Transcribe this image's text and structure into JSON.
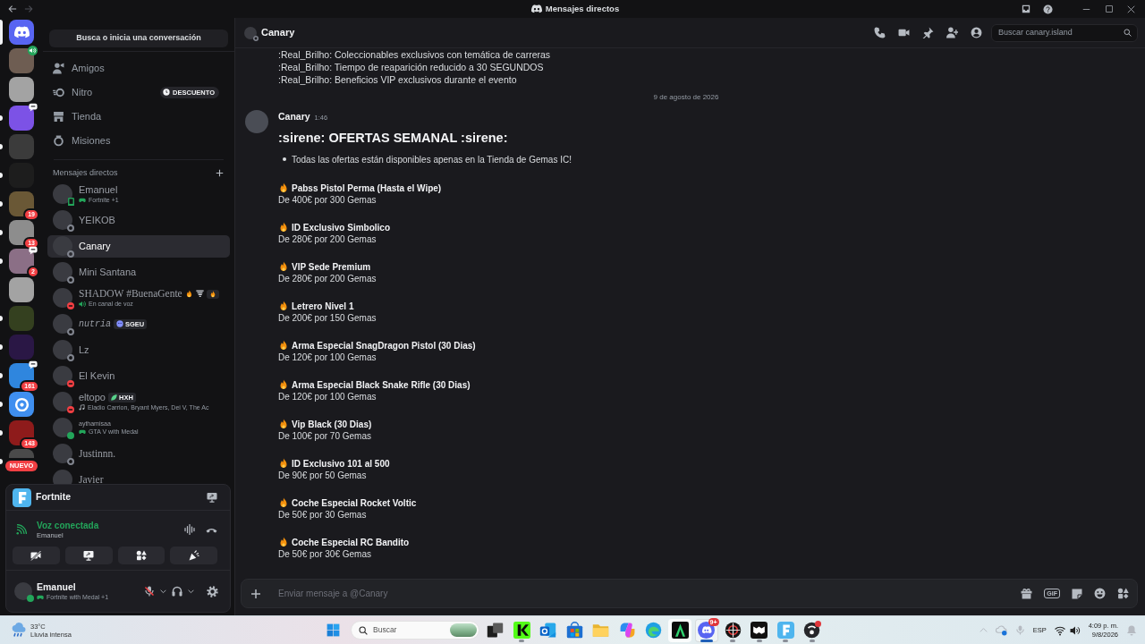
{
  "window": {
    "title": "Mensajes directos"
  },
  "servers": [
    {
      "kind": "home",
      "selected": true,
      "unread": false,
      "color": "#5865f2"
    },
    {
      "kind": "picture",
      "selected": false,
      "unread": false,
      "color": "#6e5d52",
      "corner": {
        "kind": "voice"
      }
    },
    {
      "kind": "picture",
      "selected": false,
      "unread": false,
      "color": "#a3a3a3"
    },
    {
      "kind": "picture",
      "selected": false,
      "unread": true,
      "color": "#7c52e6",
      "corner": {
        "kind": "activity"
      }
    },
    {
      "kind": "picture",
      "selected": false,
      "unread": true,
      "color": "#3b3b3b"
    },
    {
      "kind": "picture",
      "selected": false,
      "unread": true,
      "color": "#1d1d1d"
    },
    {
      "kind": "picture",
      "selected": false,
      "unread": true,
      "color": "#6a5836",
      "badge": {
        "kind": "count",
        "text": "19"
      }
    },
    {
      "kind": "picture",
      "selected": false,
      "unread": true,
      "color": "#8d8d8d",
      "badge": {
        "kind": "count",
        "text": "13"
      }
    },
    {
      "kind": "picture",
      "selected": false,
      "unread": true,
      "color": "#8b6f86",
      "badge": {
        "kind": "count",
        "text": "2"
      },
      "corner": {
        "kind": "activity"
      }
    },
    {
      "kind": "picture",
      "selected": false,
      "unread": false,
      "color": "#a3a3a3"
    },
    {
      "kind": "picture",
      "selected": false,
      "unread": true,
      "color": "#34401f"
    },
    {
      "kind": "picture",
      "selected": false,
      "unread": true,
      "color": "#2a1745"
    },
    {
      "kind": "picture",
      "selected": false,
      "unread": true,
      "color": "#2f86de",
      "badge": {
        "kind": "count",
        "text": "161"
      },
      "corner": {
        "kind": "activity"
      }
    },
    {
      "kind": "ring",
      "selected": false,
      "unread": true,
      "color": "#3f8ff0"
    },
    {
      "kind": "picture",
      "selected": false,
      "unread": true,
      "color": "#8e1b1b",
      "badge": {
        "kind": "count",
        "text": "143"
      }
    },
    {
      "kind": "picture",
      "selected": false,
      "unread": true,
      "color": "#4a4a4a",
      "badge": {
        "kind": "label",
        "text": "NUEVO"
      }
    }
  ],
  "search_button": {
    "label": "Busca o inicia una conversación"
  },
  "nav": [
    {
      "kind": "friends",
      "label": "Amigos",
      "selected": false
    },
    {
      "kind": "nitro",
      "label": "Nitro",
      "selected": false,
      "badge": "DESCUENTO"
    },
    {
      "kind": "shop",
      "label": "Tienda",
      "selected": false
    },
    {
      "kind": "quests",
      "label": "Misiones",
      "selected": false
    }
  ],
  "dm_heading": {
    "title": "Mensajes directos"
  },
  "dms": [
    {
      "name": "Emanuel",
      "presence": {
        "kind": "mobile"
      },
      "selected": false,
      "activity": {
        "kind": "game",
        "text": "Fortnite +1"
      }
    },
    {
      "name": "YEIKOB",
      "presence": {
        "kind": "offline"
      },
      "selected": false
    },
    {
      "name": "Canary",
      "presence": {
        "kind": "offline"
      },
      "selected": true
    },
    {
      "name": "Mini Santana",
      "presence": {
        "kind": "offline"
      },
      "selected": false
    },
    {
      "name": "SHADOW #BuenaGente",
      "name_font": {
        "kind": "serif"
      },
      "presence": {
        "kind": "dnd"
      },
      "selected": false,
      "emoji": [
        {
          "kind": "fire"
        },
        {
          "kind": "tornado"
        }
      ],
      "tag": {
        "kind": "flame"
      },
      "activity": {
        "kind": "voice",
        "text": "En canal de voz"
      }
    },
    {
      "name": "nutria",
      "name_font": {
        "kind": "mono-italic"
      },
      "presence": {
        "kind": "offline"
      },
      "selected": false,
      "tag": {
        "kind": "emblem",
        "text": "SGEU"
      }
    },
    {
      "name": "Lz",
      "presence": {
        "kind": "offline"
      },
      "selected": false
    },
    {
      "name": "El Kevin",
      "presence": {
        "kind": "dnd"
      },
      "selected": false
    },
    {
      "name": "eltopo",
      "presence": {
        "kind": "dnd"
      },
      "selected": false,
      "tag": {
        "kind": "leaf",
        "text": "HXH"
      },
      "activity": {
        "kind": "music",
        "text": "Eladio Carrion, Bryant Myers, Dei V, The Ac"
      }
    },
    {
      "name": "aythamisaa",
      "name_font": {
        "kind": "small"
      },
      "presence": {
        "kind": "online"
      },
      "selected": false,
      "activity": {
        "kind": "game",
        "text": "GTA V with Medal"
      }
    },
    {
      "name": "Justinnn.",
      "name_font": {
        "kind": "serif"
      },
      "presence": {
        "kind": "offline"
      },
      "selected": false
    },
    {
      "name": "Javier",
      "name_font": {
        "kind": "serif"
      },
      "presence": {
        "kind": "offline"
      },
      "selected": false
    }
  ],
  "panel": {
    "game": {
      "name": "Fortnite"
    },
    "voice": {
      "status": "Voz conectada",
      "channel": "Emanuel"
    },
    "voice_buttons": [
      {
        "kind": "camera-off"
      },
      {
        "kind": "screen-share"
      },
      {
        "kind": "activities"
      },
      {
        "kind": "soundboard"
      }
    ],
    "user": {
      "name": "Emanuel",
      "presence": {
        "kind": "online"
      },
      "mic_muted": true,
      "activity": {
        "kind": "game",
        "text": "Fortnite with Medal +1"
      }
    }
  },
  "chat_header": {
    "name": "Canary",
    "presence": {
      "kind": "offline"
    },
    "tools": [
      {
        "kind": "call"
      },
      {
        "kind": "video"
      },
      {
        "kind": "pin"
      },
      {
        "kind": "add-friend"
      },
      {
        "kind": "profile"
      }
    ],
    "search": {
      "placeholder": "Buscar canary.island"
    }
  },
  "messages": {
    "earlier_lines": [
      ":Real_Brilho: Coleccionables exclusivos con temática de carreras",
      ":Real_Brilho: Tiempo de reaparición reducido a 30 SEGUNDOS",
      ":Real_Brilho: Beneficios VIP exclusivos durante el evento"
    ],
    "date_divider": "9 de agosto de 2026",
    "post": {
      "author": "Canary",
      "time": "1:46",
      "heading": ":sirene: OFERTAS SEMANAL :sirene:",
      "bullets": [
        "Todas las ofertas están disponibles apenas en la Tienda de Gemas IC!"
      ],
      "offers": [
        {
          "title": "Pabss Pistol Perma (Hasta el Wipe)",
          "price": "De 400€ por 300 Gemas"
        },
        {
          "title": "ID Exclusivo Simbolico",
          "price": "De 280€ por 200 Gemas"
        },
        {
          "title": "VIP Sede Premium",
          "price": "De 280€ por 200 Gemas"
        },
        {
          "title": "Letrero Nivel 1",
          "price": "De 200€ por 150 Gemas"
        },
        {
          "title": "Arma Especial SnagDragon Pistol (30 Dias)",
          "price": "De 120€ por 100 Gemas"
        },
        {
          "title": "Arma Especial Black Snake Rifle (30 Dias)",
          "price": "De 120€ por 100 Gemas"
        },
        {
          "title": "Vip Black (30 Dias)",
          "price": "De 100€ por 70 Gemas"
        },
        {
          "title": "ID Exclusivo 101 al 500",
          "price": "De 90€ por 50 Gemas"
        },
        {
          "title": "Coche Especial Rocket Voltic",
          "price": "De 50€ por 30 Gemas"
        },
        {
          "title": "Coche Especial RC Bandito",
          "price": "De 50€ por 30€ Gemas"
        }
      ]
    }
  },
  "composer": {
    "placeholder": "Enviar mensaje a @Canary",
    "tools": [
      {
        "kind": "gift"
      },
      {
        "kind": "gif",
        "label": "GIF"
      },
      {
        "kind": "sticker"
      },
      {
        "kind": "emoji"
      },
      {
        "kind": "apps"
      }
    ]
  },
  "taskbar": {
    "weather": {
      "temperature": "33°C",
      "condition": "Lluvia intensa"
    },
    "search": {
      "placeholder": "Buscar"
    },
    "apps": [
      {
        "kind": "task-view",
        "running": false,
        "focused": false,
        "hovered": false,
        "alert": false
      },
      {
        "kind": "k-tile",
        "running": true,
        "focused": false,
        "hovered": false,
        "alert": false
      },
      {
        "kind": "mail",
        "running": false,
        "focused": false,
        "hovered": false,
        "alert": false
      },
      {
        "kind": "store",
        "running": false,
        "focused": false,
        "hovered": false,
        "alert": false
      },
      {
        "kind": "folder",
        "running": false,
        "focused": false,
        "hovered": false,
        "alert": false
      },
      {
        "kind": "copilot",
        "running": false,
        "focused": false,
        "hovered": false,
        "alert": false
      },
      {
        "kind": "browser",
        "running": false,
        "focused": false,
        "hovered": false,
        "alert": false
      },
      {
        "kind": "peak",
        "running": false,
        "focused": false,
        "hovered": true,
        "alert": false
      },
      {
        "kind": "chat",
        "running": true,
        "focused": true,
        "hovered": false,
        "alert": false,
        "badge": "9+"
      },
      {
        "kind": "target",
        "running": true,
        "focused": false,
        "hovered": false,
        "alert": false
      },
      {
        "kind": "mask",
        "running": true,
        "focused": false,
        "hovered": false,
        "alert": false
      },
      {
        "kind": "f-tile",
        "running": true,
        "focused": false,
        "hovered": false,
        "alert": false
      },
      {
        "kind": "orb",
        "running": true,
        "focused": false,
        "hovered": false,
        "alert": true
      }
    ],
    "tray": {
      "language": "ESP",
      "time": "4:09 p. m.",
      "date": "9/8/2026"
    }
  }
}
